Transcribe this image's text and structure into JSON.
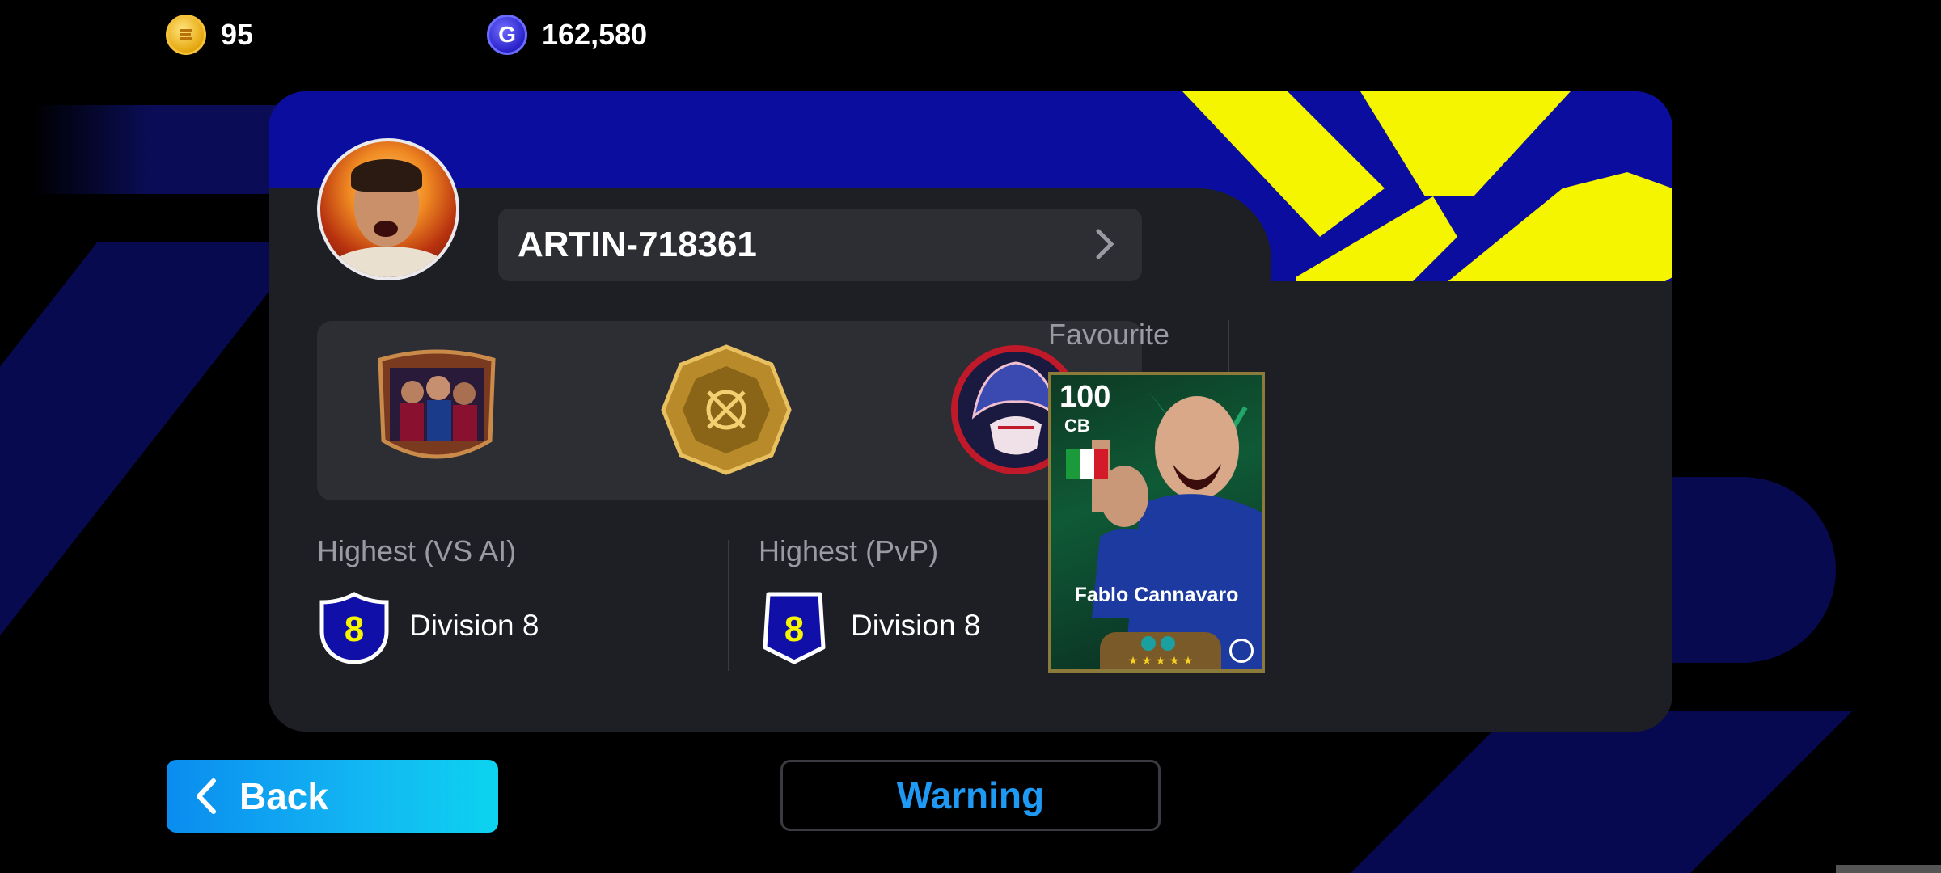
{
  "currency": {
    "coins": {
      "icon": "efootball-coin-icon",
      "value": "95"
    },
    "gp": {
      "icon": "gp-coin-icon",
      "glyph": "G",
      "value": "162,580"
    }
  },
  "profile": {
    "username": "ARTIN-718361",
    "avatar": "goalkeeper-avatar",
    "emblems": [
      "team-photo-emblem",
      "gold-badge-emblem",
      "red-helmet-emblem"
    ]
  },
  "ranks": {
    "vs_ai": {
      "label": "Highest (VS AI)",
      "badge_number": "8",
      "division": "Division 8"
    },
    "pvp": {
      "label": "Highest (PvP)",
      "badge_number": "8",
      "division": "Division 8"
    }
  },
  "favourite": {
    "label": "Favourite",
    "player": {
      "rating": "100",
      "position": "CB",
      "name": "Fablo Cannavaro",
      "nation_flag": "italy-flag"
    }
  },
  "buttons": {
    "back": "Back",
    "warning": "Warning"
  },
  "colors": {
    "banner_blue": "#0b0d9e",
    "banner_yellow": "#f5f500",
    "card_bg": "#1e1f24",
    "accent_cyan": "#13b7f2",
    "warning_text": "#1e9af5"
  }
}
